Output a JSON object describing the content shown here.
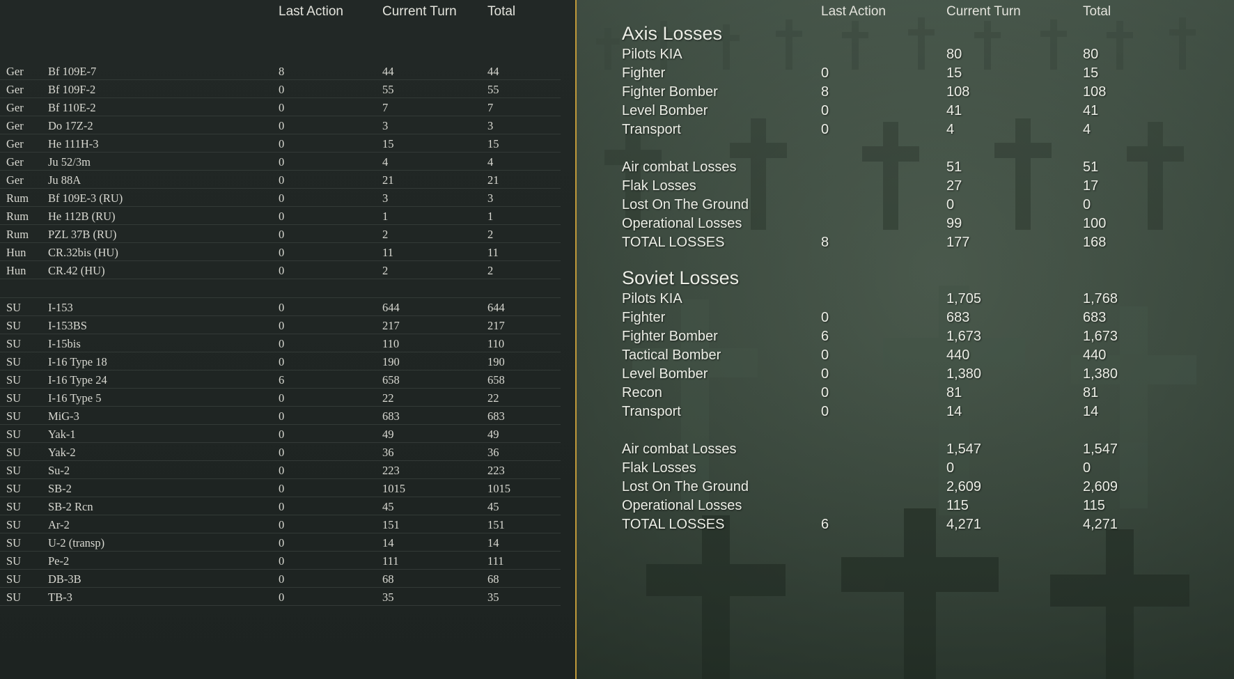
{
  "left": {
    "headers": {
      "last_action": "Last Action",
      "current_turn": "Current Turn",
      "total": "Total"
    },
    "axis_rows": [
      {
        "nat": "Ger",
        "type": "Bf 109E-7",
        "last": "8",
        "cur": "44",
        "tot": "44"
      },
      {
        "nat": "Ger",
        "type": "Bf 109F-2",
        "last": "0",
        "cur": "55",
        "tot": "55"
      },
      {
        "nat": "Ger",
        "type": "Bf 110E-2",
        "last": "0",
        "cur": "7",
        "tot": "7"
      },
      {
        "nat": "Ger",
        "type": "Do 17Z-2",
        "last": "0",
        "cur": "3",
        "tot": "3"
      },
      {
        "nat": "Ger",
        "type": "He 111H-3",
        "last": "0",
        "cur": "15",
        "tot": "15"
      },
      {
        "nat": "Ger",
        "type": "Ju 52/3m",
        "last": "0",
        "cur": "4",
        "tot": "4"
      },
      {
        "nat": "Ger",
        "type": "Ju 88A",
        "last": "0",
        "cur": "21",
        "tot": "21"
      },
      {
        "nat": "Rum",
        "type": "Bf 109E-3 (RU)",
        "last": "0",
        "cur": "3",
        "tot": "3"
      },
      {
        "nat": "Rum",
        "type": "He 112B (RU)",
        "last": "0",
        "cur": "1",
        "tot": "1"
      },
      {
        "nat": "Rum",
        "type": "PZL 37B (RU)",
        "last": "0",
        "cur": "2",
        "tot": "2"
      },
      {
        "nat": "Hun",
        "type": "CR.32bis (HU)",
        "last": "0",
        "cur": "11",
        "tot": "11"
      },
      {
        "nat": "Hun",
        "type": "CR.42 (HU)",
        "last": "0",
        "cur": "2",
        "tot": "2"
      }
    ],
    "soviet_rows": [
      {
        "nat": "SU",
        "type": "I-153",
        "last": "0",
        "cur": "644",
        "tot": "644"
      },
      {
        "nat": "SU",
        "type": "I-153BS",
        "last": "0",
        "cur": "217",
        "tot": "217"
      },
      {
        "nat": "SU",
        "type": "I-15bis",
        "last": "0",
        "cur": "110",
        "tot": "110"
      },
      {
        "nat": "SU",
        "type": "I-16 Type 18",
        "last": "0",
        "cur": "190",
        "tot": "190"
      },
      {
        "nat": "SU",
        "type": "I-16 Type 24",
        "last": "6",
        "cur": "658",
        "tot": "658"
      },
      {
        "nat": "SU",
        "type": "I-16 Type 5",
        "last": "0",
        "cur": "22",
        "tot": "22"
      },
      {
        "nat": "SU",
        "type": "MiG-3",
        "last": "0",
        "cur": "683",
        "tot": "683"
      },
      {
        "nat": "SU",
        "type": "Yak-1",
        "last": "0",
        "cur": "49",
        "tot": "49"
      },
      {
        "nat": "SU",
        "type": "Yak-2",
        "last": "0",
        "cur": "36",
        "tot": "36"
      },
      {
        "nat": "SU",
        "type": "Su-2",
        "last": "0",
        "cur": "223",
        "tot": "223"
      },
      {
        "nat": "SU",
        "type": "SB-2",
        "last": "0",
        "cur": "1015",
        "tot": "1015"
      },
      {
        "nat": "SU",
        "type": "SB-2 Rcn",
        "last": "0",
        "cur": "45",
        "tot": "45"
      },
      {
        "nat": "SU",
        "type": "Ar-2",
        "last": "0",
        "cur": "151",
        "tot": "151"
      },
      {
        "nat": "SU",
        "type": "U-2 (transp)",
        "last": "0",
        "cur": "14",
        "tot": "14"
      },
      {
        "nat": "SU",
        "type": "Pe-2",
        "last": "0",
        "cur": "111",
        "tot": "111"
      },
      {
        "nat": "SU",
        "type": "DB-3B",
        "last": "0",
        "cur": "68",
        "tot": "68"
      },
      {
        "nat": "SU",
        "type": "TB-3",
        "last": "0",
        "cur": "35",
        "tot": "35"
      }
    ]
  },
  "right": {
    "headers": {
      "last_action": "Last Action",
      "current_turn": "Current Turn",
      "total": "Total"
    },
    "axis": {
      "title": "Axis Losses",
      "rows": [
        {
          "label": "Pilots KIA",
          "last": "",
          "cur": "80",
          "tot": "80"
        },
        {
          "label": "Fighter",
          "last": "0",
          "cur": "15",
          "tot": "15"
        },
        {
          "label": "Fighter Bomber",
          "last": "8",
          "cur": "108",
          "tot": "108"
        },
        {
          "label": "Level Bomber",
          "last": "0",
          "cur": "41",
          "tot": "41"
        },
        {
          "label": "Transport",
          "last": "0",
          "cur": "4",
          "tot": "4"
        }
      ],
      "summary": [
        {
          "label": "Air combat Losses",
          "last": "",
          "cur": "51",
          "tot": "51"
        },
        {
          "label": "Flak Losses",
          "last": "",
          "cur": "27",
          "tot": "17"
        },
        {
          "label": "Lost On The Ground",
          "last": "",
          "cur": "0",
          "tot": "0"
        },
        {
          "label": "Operational Losses",
          "last": "",
          "cur": "99",
          "tot": "100"
        },
        {
          "label": "TOTAL LOSSES",
          "last": "8",
          "cur": "177",
          "tot": "168"
        }
      ]
    },
    "soviet": {
      "title": "Soviet Losses",
      "rows": [
        {
          "label": "Pilots KIA",
          "last": "",
          "cur": "1,705",
          "tot": "1,768"
        },
        {
          "label": "Fighter",
          "last": "0",
          "cur": "683",
          "tot": "683"
        },
        {
          "label": "Fighter Bomber",
          "last": "6",
          "cur": "1,673",
          "tot": "1,673"
        },
        {
          "label": "Tactical Bomber",
          "last": "0",
          "cur": "440",
          "tot": "440"
        },
        {
          "label": "Level Bomber",
          "last": "0",
          "cur": "1,380",
          "tot": "1,380"
        },
        {
          "label": "Recon",
          "last": "0",
          "cur": "81",
          "tot": "81"
        },
        {
          "label": "Transport",
          "last": "0",
          "cur": "14",
          "tot": "14"
        }
      ],
      "summary": [
        {
          "label": "Air combat Losses",
          "last": "",
          "cur": "1,547",
          "tot": "1,547"
        },
        {
          "label": "Flak Losses",
          "last": "",
          "cur": "0",
          "tot": "0"
        },
        {
          "label": "Lost On The Ground",
          "last": "",
          "cur": "2,609",
          "tot": "2,609"
        },
        {
          "label": "Operational Losses",
          "last": "",
          "cur": "115",
          "tot": "115"
        },
        {
          "label": "TOTAL LOSSES",
          "last": "6",
          "cur": "4,271",
          "tot": "4,271"
        }
      ]
    }
  },
  "colors": {
    "divider": "#c19a3a",
    "left_bg": "#1f2523",
    "right_bg": "#3c4a3f",
    "text": "#e3e3dc"
  }
}
